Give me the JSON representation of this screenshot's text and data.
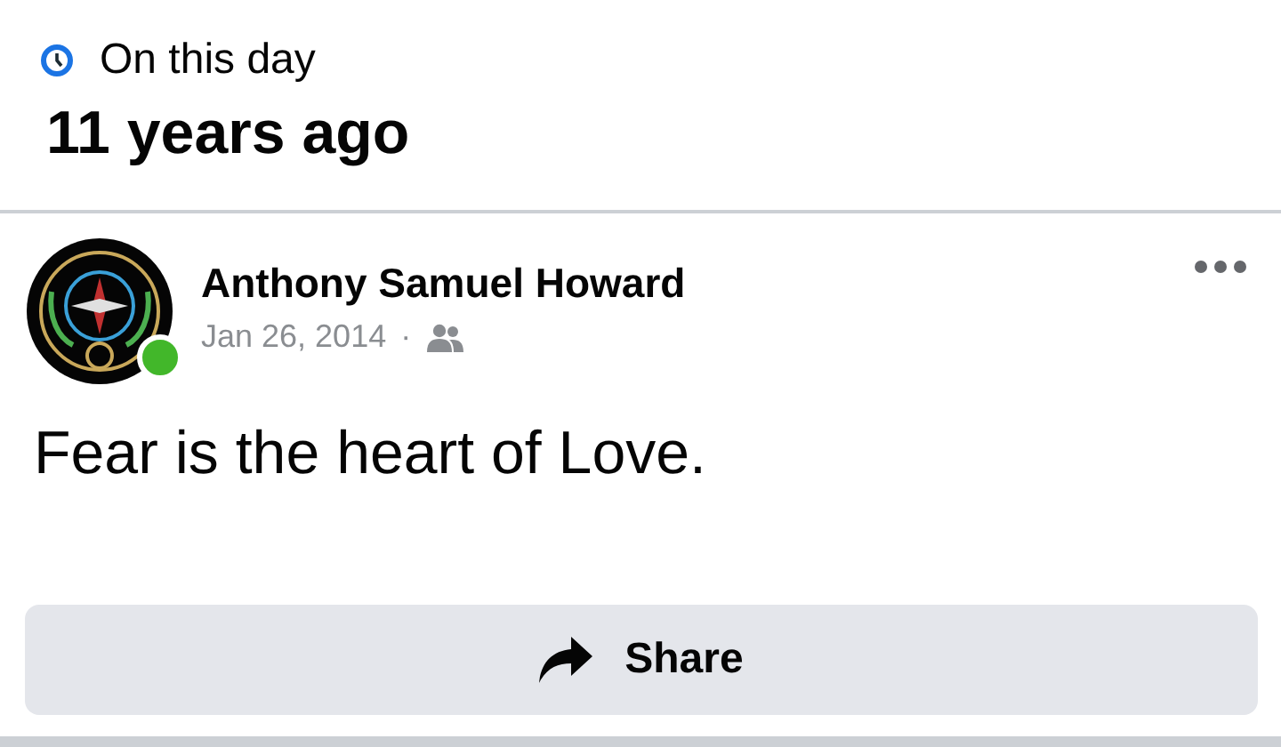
{
  "header": {
    "label": "On this day",
    "title": "11 years ago"
  },
  "post": {
    "author": "Anthony Samuel Howard",
    "online": true,
    "date": "Jan 26, 2014",
    "separator": "·",
    "text": "Fear is the heart of Love."
  },
  "actions": [
    {
      "label": "Share",
      "kind": "share"
    }
  ]
}
